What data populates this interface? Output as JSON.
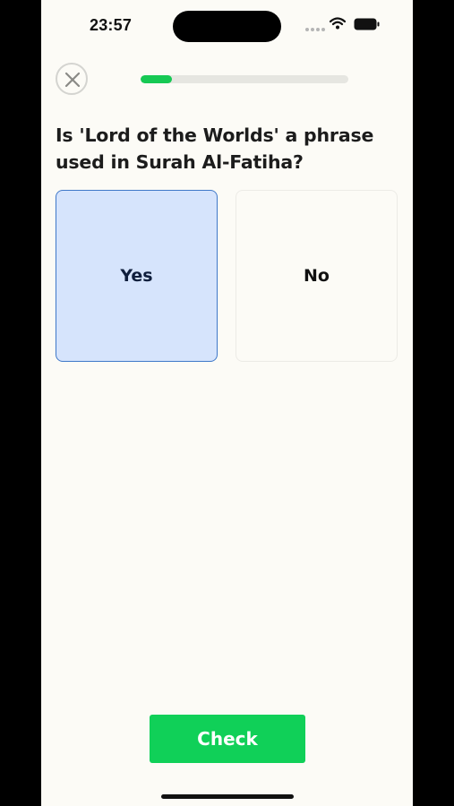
{
  "status_bar": {
    "time": "23:57",
    "icons": [
      "signal-icon",
      "wifi-icon",
      "battery-icon"
    ]
  },
  "header": {
    "close_icon": "close-icon",
    "progress": 0.15,
    "progress_color": "#16c954"
  },
  "question": {
    "text": "Is 'Lord of the Worlds' a phrase used in Surah Al-Fatiha?"
  },
  "options": [
    {
      "label": "Yes",
      "selected": true
    },
    {
      "label": "No",
      "selected": false
    }
  ],
  "footer": {
    "check_label": "Check",
    "check_color": "#10d058"
  },
  "colors": {
    "background": "#fcfbf6",
    "selected_fill": "#d6e4fc",
    "selected_border": "#3f78c9"
  }
}
